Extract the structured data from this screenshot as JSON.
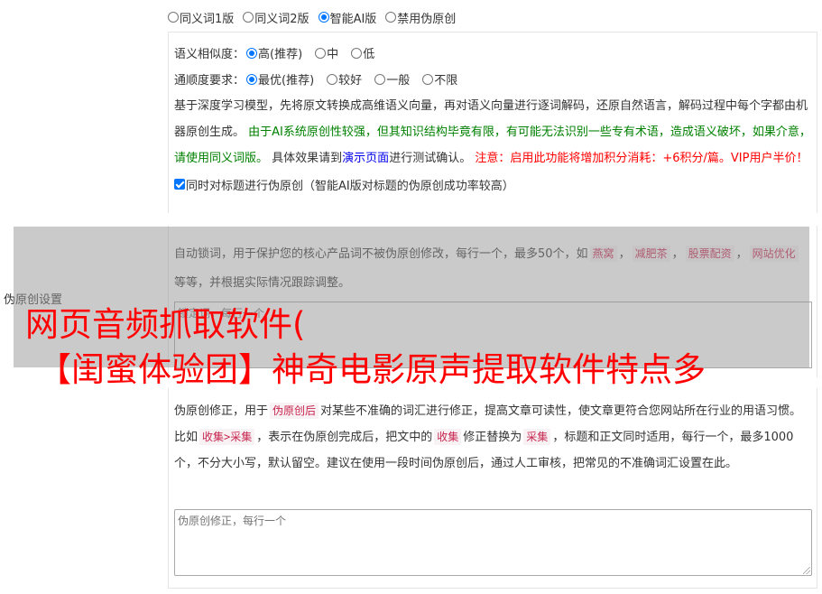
{
  "mode_options": [
    {
      "label": "同义词1版",
      "checked": false
    },
    {
      "label": "同义词2版",
      "checked": false
    },
    {
      "label": "智能AI版",
      "checked": true
    },
    {
      "label": "禁用伪原创",
      "checked": false
    }
  ],
  "similarity": {
    "label": "语义相似度：",
    "options": [
      {
        "label": "高(推荐)",
        "checked": true
      },
      {
        "label": "中",
        "checked": false
      },
      {
        "label": "低",
        "checked": false
      }
    ]
  },
  "fluency": {
    "label": "通顺度要求：",
    "options": [
      {
        "label": "最优(推荐)",
        "checked": true
      },
      {
        "label": "较好",
        "checked": false
      },
      {
        "label": "一般",
        "checked": false
      },
      {
        "label": "不限",
        "checked": false
      }
    ]
  },
  "ai_desc": {
    "part1": "基于深度学习模型，先将原文转换成高维语义向量，再对语义向量进行逐词解码，还原自然语言，解码过程中每个字都由机器原创生成。",
    "part2": "由于AI系统原创性较强，但其知识结构毕竟有限，有可能无法识别一些专有术语，造成语义破坏，如果介意，请使用同义词版。",
    "part3": "具体效果请到",
    "link": "演示页面",
    "part4": "进行测试确认。",
    "warning": "注意：启用此功能将增加积分消耗：+6积分/篇。VIP用户半价！"
  },
  "title_option": {
    "label": "同时对标题进行伪原创（智能AI版对标题的伪原创成功率较高）",
    "checked": true
  },
  "side_label": "伪原创设置",
  "lock": {
    "desc1": "自动锁词，用于保护您的核心产品词不被伪原创修改，每行一个，最多50个，如",
    "chips": [
      "燕窝",
      "减肥茶",
      "股票配资",
      "网站优化"
    ],
    "sep": "，",
    "desc2": "等等，并根据实际情况跟踪调整。",
    "placeholder": "锁定词，每行一个"
  },
  "headline": {
    "line1": "网页音频抓取软件(",
    "line2": "【闺蜜体验团】神奇电影原声提取软件特点多"
  },
  "fix": {
    "d1": "伪原创修正，用于",
    "chip1": "伪原创后",
    "d2": "对某些不准确的词汇进行修正，提高文章可读性，使文章更符合您网站所在行业的用语习惯。比如",
    "chip2": "收集>采集",
    "d3": "，表示在伪原创完成后，把文中的",
    "chip3": "收集",
    "d4": "修正替换为",
    "chip4": "采集",
    "d5": "，标题和正文同时适用，每行一个，最多1000个，不分大小写，默认留空。建议在使用一段时间伪原创后，通过人工审核，把常见的不准确词汇设置在此。",
    "placeholder": "伪原创修正，每行一个"
  }
}
